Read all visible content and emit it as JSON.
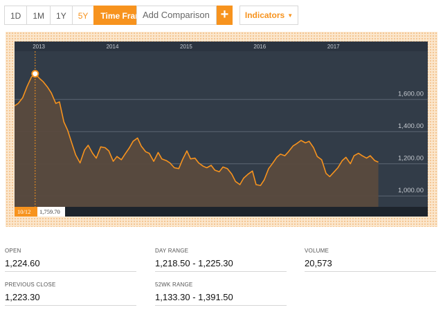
{
  "toolbar": {
    "timeframes": [
      "1D",
      "1M",
      "1Y",
      "5Y"
    ],
    "active_timeframe": "5Y",
    "time_frame_label": "Time Frame",
    "comparison_placeholder": "Add Comparison",
    "add_icon": "+",
    "indicators_label": "Indicators",
    "indicators_caret": "▼"
  },
  "colors": {
    "accent": "#f7931e",
    "plot_bg": "#323c48",
    "area_fill": "#5a4a3e",
    "grid": "#5d6774",
    "text_light": "#c7ccd2"
  },
  "chart_data": {
    "type": "area",
    "x_tick_labels": [
      "2013",
      "2014",
      "2015",
      "2016",
      "2017"
    ],
    "y_tick_labels": [
      "1,000.00",
      "1,200.00",
      "1,400.00",
      "1,600.00"
    ],
    "y_ticks": [
      1000,
      1200,
      1400,
      1600
    ],
    "ylim": [
      932,
      1900
    ],
    "xlim": [
      2012.67,
      2017.67
    ],
    "grid": true,
    "crosshair": {
      "date_label": "10/12",
      "value_label": "1,759.70",
      "x": 2012.95,
      "y": 1759.7
    },
    "series": [
      {
        "x": [
          2012.67,
          2012.72,
          2012.78,
          2012.84,
          2012.9,
          2012.95,
          2013.01,
          2013.06,
          2013.12,
          2013.17,
          2013.23,
          2013.28,
          2013.34,
          2013.39,
          2013.45,
          2013.5,
          2013.56,
          2013.62,
          2013.67,
          2013.73,
          2013.78,
          2013.84,
          2013.9,
          2013.95,
          2014.01,
          2014.06,
          2014.12,
          2014.17,
          2014.23,
          2014.28,
          2014.34,
          2014.39,
          2014.45,
          2014.5,
          2014.56,
          2014.62,
          2014.67,
          2014.73,
          2014.78,
          2014.84,
          2014.9,
          2014.95,
          2015.01,
          2015.06,
          2015.12,
          2015.17,
          2015.23,
          2015.28,
          2015.34,
          2015.39,
          2015.45,
          2015.5,
          2015.56,
          2015.62,
          2015.67,
          2015.73,
          2015.78,
          2015.84,
          2015.9,
          2015.95,
          2016.01,
          2016.06,
          2016.12,
          2016.17,
          2016.23,
          2016.28,
          2016.34,
          2016.39,
          2016.45,
          2016.5,
          2016.56,
          2016.62,
          2016.67,
          2016.73,
          2016.78,
          2016.84,
          2016.9,
          2016.95,
          2017.01,
          2017.06,
          2017.12,
          2017.17,
          2017.23,
          2017.28,
          2017.34,
          2017.39,
          2017.45,
          2017.5,
          2017.56,
          2017.61
        ],
        "y": [
          1560,
          1575,
          1610,
          1680,
          1740,
          1759.7,
          1730,
          1710,
          1675,
          1640,
          1575,
          1585,
          1460,
          1410,
          1325,
          1255,
          1205,
          1285,
          1315,
          1265,
          1235,
          1305,
          1300,
          1280,
          1215,
          1245,
          1225,
          1260,
          1300,
          1340,
          1360,
          1310,
          1275,
          1265,
          1215,
          1270,
          1230,
          1220,
          1205,
          1175,
          1170,
          1225,
          1280,
          1230,
          1235,
          1205,
          1185,
          1175,
          1190,
          1160,
          1150,
          1180,
          1170,
          1135,
          1090,
          1070,
          1110,
          1135,
          1155,
          1070,
          1065,
          1100,
          1170,
          1200,
          1240,
          1260,
          1250,
          1275,
          1310,
          1325,
          1345,
          1330,
          1340,
          1300,
          1245,
          1225,
          1140,
          1120,
          1150,
          1175,
          1220,
          1240,
          1200,
          1250,
          1265,
          1250,
          1235,
          1250,
          1220,
          1210
        ]
      }
    ]
  },
  "stats": [
    {
      "label": "OPEN",
      "value": "1,224.60"
    },
    {
      "label": "DAY RANGE",
      "value": "1,218.50 - 1,225.30"
    },
    {
      "label": "VOLUME",
      "value": "20,573"
    },
    {
      "label": "PREVIOUS CLOSE",
      "value": "1,223.30"
    },
    {
      "label": "52WK RANGE",
      "value": "1,133.30 - 1,391.50"
    }
  ]
}
